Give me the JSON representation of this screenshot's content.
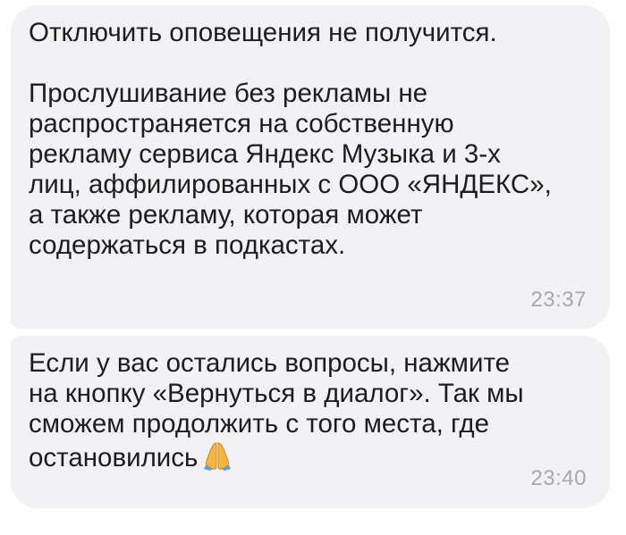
{
  "messages": [
    {
      "paragraph_1": "Отключить оповещения не получится.",
      "paragraph_2": "Прослушивание без рекламы не\nраспространяется на собственную\nрекламу сервиса Яндекс Музыка и 3-х\nлиц, аффилированных с ООО «ЯНДЕКС»,\nа также рекламу, которая может\nсодержаться в подкастах.",
      "time": "23:37"
    },
    {
      "text": "Если у вас остались вопросы, нажмите\nна кнопку «Вернуться в диалог». Так мы\nсможем продолжить с того места, где\nостановились",
      "emoji": "folded-hands-icon",
      "time": "23:40"
    }
  ],
  "colors": {
    "bubble_background": "#f2f2f4",
    "text": "#1d1d1f",
    "timestamp": "#a8a8ad",
    "emoji": "#f6b53f"
  }
}
